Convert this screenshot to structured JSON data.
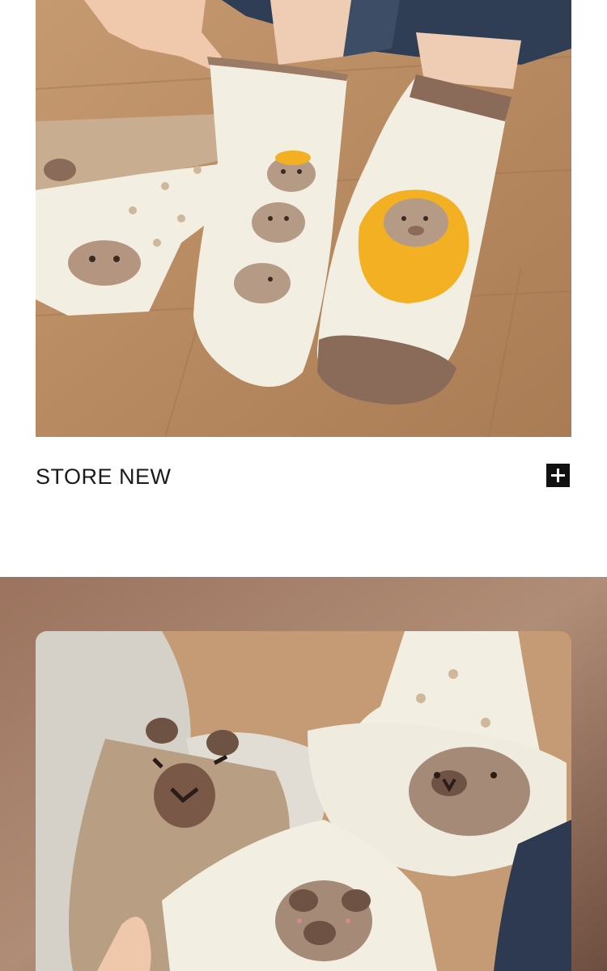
{
  "caption": {
    "text": "STORE NEW"
  },
  "icons": {
    "plus": "plus-square-icon"
  },
  "colors": {
    "page_background": "#ffffff",
    "floor_wood": "#b58a62",
    "sock_cream": "#f3eee2",
    "sock_brown": "#8a6a58",
    "sock_tan": "#c8ad90",
    "orange_accent": "#f2b022",
    "banner_frame": "#8a6552"
  }
}
